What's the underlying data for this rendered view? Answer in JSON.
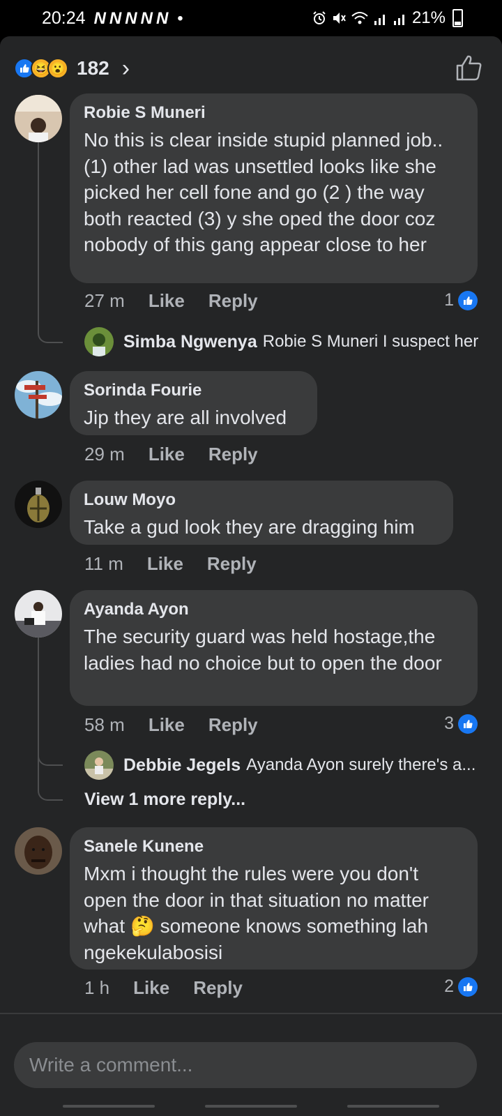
{
  "status_bar": {
    "time": "20:24",
    "notif_glyphs": [
      "N",
      "N",
      "N",
      "N",
      "N"
    ],
    "dot": "•",
    "battery": "21%"
  },
  "header": {
    "reaction_count": "182",
    "chevron": "›"
  },
  "comments": [
    {
      "name": "Robie S Muneri",
      "text": "No this is clear inside stupid planned job..(1) other lad was unsettled looks like she picked her cell fone and go (2 ) the way both reacted (3) y she oped the door coz nobody of this gang appear close to her",
      "time": "27 m",
      "like": "Like",
      "reply": "Reply",
      "reactions": "1"
    },
    {
      "name": "Sorinda Fourie",
      "text": "Jip they are all involved",
      "time": "29 m",
      "like": "Like",
      "reply": "Reply"
    },
    {
      "name": "Louw Moyo",
      "text": "Take a gud look they are dragging him",
      "time": "11 m",
      "like": "Like",
      "reply": "Reply"
    },
    {
      "name": "Ayanda Ayon",
      "text": "The security guard was held hostage,the ladies had no choice but to open the door",
      "time": "58 m",
      "like": "Like",
      "reply": "Reply",
      "reactions": "3"
    },
    {
      "name": "Sanele Kunene",
      "text_before": "Mxm i thought the rules were you don't open the door in that situation no matter what ",
      "emoji": "🤔",
      "text_after": " someone knows something lah ngekekulabosisi",
      "time": "1 h",
      "like": "Like",
      "reply": "Reply",
      "reactions": "2"
    }
  ],
  "replies": [
    {
      "name": "Simba Ngwenya",
      "text": "Robie S Muneri I suspect her"
    },
    {
      "name": "Debbie Jegels",
      "text": "Ayanda Ayon surely there's a..."
    }
  ],
  "view_more": "View 1 more reply...",
  "composer": {
    "placeholder": "Write a comment..."
  },
  "colors": {
    "background": "#242526",
    "bubble": "#3a3b3c",
    "accent": "#1877f2",
    "muted": "#b0b3b8"
  }
}
